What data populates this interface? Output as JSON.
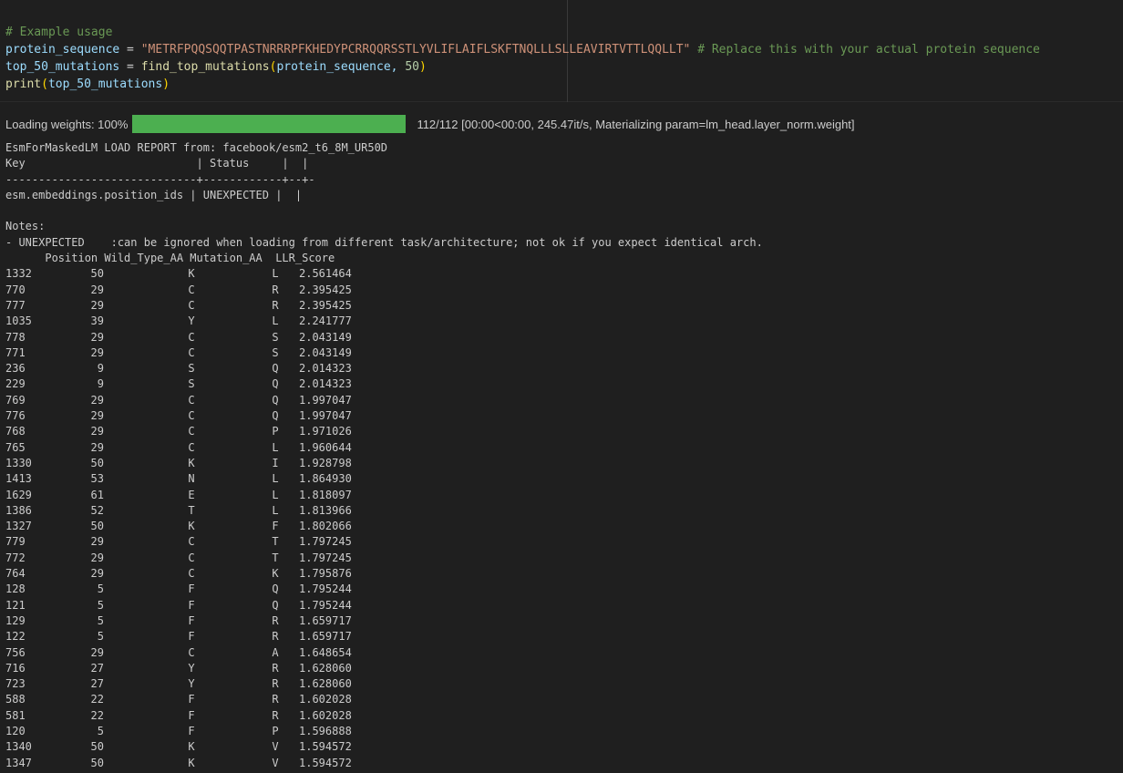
{
  "code": {
    "line1": "# Example usage",
    "line2_var": "protein_sequence",
    "line2_eq": " = ",
    "line2_str": "\"METRFPQQSQQTPASTNRRRPFKHEDYPCRRQQRSSTLYVLIFLAIFLSKFTNQLLLSLLEAVIRTVTTLQQLLT\"",
    "line2_comment": " # Replace this with your actual protein sequence",
    "line3_var": "top_50_mutations",
    "line3_eq": " = ",
    "line3_func": "find_top_mutations",
    "line3_open": "(",
    "line3_arg": "protein_sequence, ",
    "line3_num": "50",
    "line3_close": ")",
    "line4_func": "print",
    "line4_open": "(",
    "line4_arg": "top_50_mutations",
    "line4_close": ")"
  },
  "progress": {
    "label": "Loading weights: 100%",
    "fraction": 1.0,
    "fill_color": "#4caf50",
    "status": "112/112 [00:00<00:00, 245.47it/s, Materializing param=lm_head.layer_norm.weight]"
  },
  "load_report": "EsmForMaskedLM LOAD REPORT from: facebook/esm2_t6_8M_UR50D\nKey                          | Status     |  | \n-----------------------------+------------+--+-\nesm.embeddings.position_ids | UNEXPECTED |  | \n\nNotes:\n- UNEXPECTED    :can be ignored when loading from different task/architecture; not ok if you expect identical arch.",
  "results": {
    "header": "      Position Wild_Type_AA Mutation_AA  LLR_Score",
    "rows": [
      {
        "idx": "1332",
        "pos": "50",
        "wt": "K",
        "mut": "L",
        "llr": "2.561464"
      },
      {
        "idx": "770",
        "pos": "29",
        "wt": "C",
        "mut": "R",
        "llr": "2.395425"
      },
      {
        "idx": "777",
        "pos": "29",
        "wt": "C",
        "mut": "R",
        "llr": "2.395425"
      },
      {
        "idx": "1035",
        "pos": "39",
        "wt": "Y",
        "mut": "L",
        "llr": "2.241777"
      },
      {
        "idx": "778",
        "pos": "29",
        "wt": "C",
        "mut": "S",
        "llr": "2.043149"
      },
      {
        "idx": "771",
        "pos": "29",
        "wt": "C",
        "mut": "S",
        "llr": "2.043149"
      },
      {
        "idx": "236",
        "pos": "9",
        "wt": "S",
        "mut": "Q",
        "llr": "2.014323"
      },
      {
        "idx": "229",
        "pos": "9",
        "wt": "S",
        "mut": "Q",
        "llr": "2.014323"
      },
      {
        "idx": "769",
        "pos": "29",
        "wt": "C",
        "mut": "Q",
        "llr": "1.997047"
      },
      {
        "idx": "776",
        "pos": "29",
        "wt": "C",
        "mut": "Q",
        "llr": "1.997047"
      },
      {
        "idx": "768",
        "pos": "29",
        "wt": "C",
        "mut": "P",
        "llr": "1.971026"
      },
      {
        "idx": "765",
        "pos": "29",
        "wt": "C",
        "mut": "L",
        "llr": "1.960644"
      },
      {
        "idx": "1330",
        "pos": "50",
        "wt": "K",
        "mut": "I",
        "llr": "1.928798"
      },
      {
        "idx": "1413",
        "pos": "53",
        "wt": "N",
        "mut": "L",
        "llr": "1.864930"
      },
      {
        "idx": "1629",
        "pos": "61",
        "wt": "E",
        "mut": "L",
        "llr": "1.818097"
      },
      {
        "idx": "1386",
        "pos": "52",
        "wt": "T",
        "mut": "L",
        "llr": "1.813966"
      },
      {
        "idx": "1327",
        "pos": "50",
        "wt": "K",
        "mut": "F",
        "llr": "1.802066"
      },
      {
        "idx": "779",
        "pos": "29",
        "wt": "C",
        "mut": "T",
        "llr": "1.797245"
      },
      {
        "idx": "772",
        "pos": "29",
        "wt": "C",
        "mut": "T",
        "llr": "1.797245"
      },
      {
        "idx": "764",
        "pos": "29",
        "wt": "C",
        "mut": "K",
        "llr": "1.795876"
      },
      {
        "idx": "128",
        "pos": "5",
        "wt": "F",
        "mut": "Q",
        "llr": "1.795244"
      },
      {
        "idx": "121",
        "pos": "5",
        "wt": "F",
        "mut": "Q",
        "llr": "1.795244"
      },
      {
        "idx": "129",
        "pos": "5",
        "wt": "F",
        "mut": "R",
        "llr": "1.659717"
      },
      {
        "idx": "122",
        "pos": "5",
        "wt": "F",
        "mut": "R",
        "llr": "1.659717"
      },
      {
        "idx": "756",
        "pos": "29",
        "wt": "C",
        "mut": "A",
        "llr": "1.648654"
      },
      {
        "idx": "716",
        "pos": "27",
        "wt": "Y",
        "mut": "R",
        "llr": "1.628060"
      },
      {
        "idx": "723",
        "pos": "27",
        "wt": "Y",
        "mut": "R",
        "llr": "1.628060"
      },
      {
        "idx": "588",
        "pos": "22",
        "wt": "F",
        "mut": "R",
        "llr": "1.602028"
      },
      {
        "idx": "581",
        "pos": "22",
        "wt": "F",
        "mut": "R",
        "llr": "1.602028"
      },
      {
        "idx": "120",
        "pos": "5",
        "wt": "F",
        "mut": "P",
        "llr": "1.596888"
      },
      {
        "idx": "1340",
        "pos": "50",
        "wt": "K",
        "mut": "V",
        "llr": "1.594572"
      },
      {
        "idx": "1347",
        "pos": "50",
        "wt": "K",
        "mut": "V",
        "llr": "1.594572"
      }
    ]
  }
}
